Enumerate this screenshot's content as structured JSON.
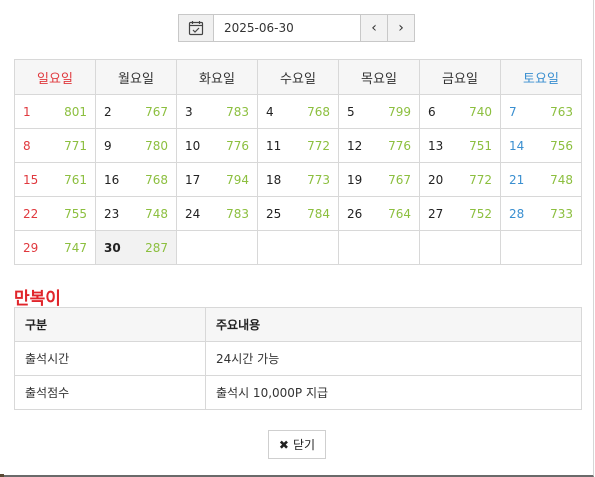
{
  "date_picker": {
    "value": "2025-06-30",
    "prev_icon": "‹",
    "next_icon": "›"
  },
  "calendar": {
    "weekdays": [
      "일요일",
      "월요일",
      "화요일",
      "수요일",
      "목요일",
      "금요일",
      "토요일"
    ],
    "weeks": [
      [
        {
          "day": "1",
          "count": "801"
        },
        {
          "day": "2",
          "count": "767"
        },
        {
          "day": "3",
          "count": "783"
        },
        {
          "day": "4",
          "count": "768"
        },
        {
          "day": "5",
          "count": "799"
        },
        {
          "day": "6",
          "count": "740"
        },
        {
          "day": "7",
          "count": "763"
        }
      ],
      [
        {
          "day": "8",
          "count": "771"
        },
        {
          "day": "9",
          "count": "780"
        },
        {
          "day": "10",
          "count": "776"
        },
        {
          "day": "11",
          "count": "772"
        },
        {
          "day": "12",
          "count": "776"
        },
        {
          "day": "13",
          "count": "751"
        },
        {
          "day": "14",
          "count": "756"
        }
      ],
      [
        {
          "day": "15",
          "count": "761"
        },
        {
          "day": "16",
          "count": "768"
        },
        {
          "day": "17",
          "count": "794"
        },
        {
          "day": "18",
          "count": "773"
        },
        {
          "day": "19",
          "count": "767"
        },
        {
          "day": "20",
          "count": "772"
        },
        {
          "day": "21",
          "count": "748"
        }
      ],
      [
        {
          "day": "22",
          "count": "755"
        },
        {
          "day": "23",
          "count": "748"
        },
        {
          "day": "24",
          "count": "783"
        },
        {
          "day": "25",
          "count": "784"
        },
        {
          "day": "26",
          "count": "764"
        },
        {
          "day": "27",
          "count": "752"
        },
        {
          "day": "28",
          "count": "733"
        }
      ],
      [
        {
          "day": "29",
          "count": "747"
        },
        {
          "day": "30",
          "count": "287",
          "today": true
        },
        {
          "day": "",
          "count": ""
        },
        {
          "day": "",
          "count": ""
        },
        {
          "day": "",
          "count": ""
        },
        {
          "day": "",
          "count": ""
        },
        {
          "day": "",
          "count": ""
        }
      ]
    ]
  },
  "section_title": "만복이",
  "info_table": {
    "headers": [
      "구분",
      "주요내용"
    ],
    "rows": [
      [
        "출석시간",
        "24시간 가능"
      ],
      [
        "출석점수",
        "출석시 10,000P 지급"
      ]
    ]
  },
  "close_button": {
    "icon": "✖",
    "label": "닫기"
  },
  "colors": {
    "sunday": "#e0393e",
    "saturday": "#3a8fd0",
    "count": "#8cbf3f",
    "title": "#e0252b"
  }
}
